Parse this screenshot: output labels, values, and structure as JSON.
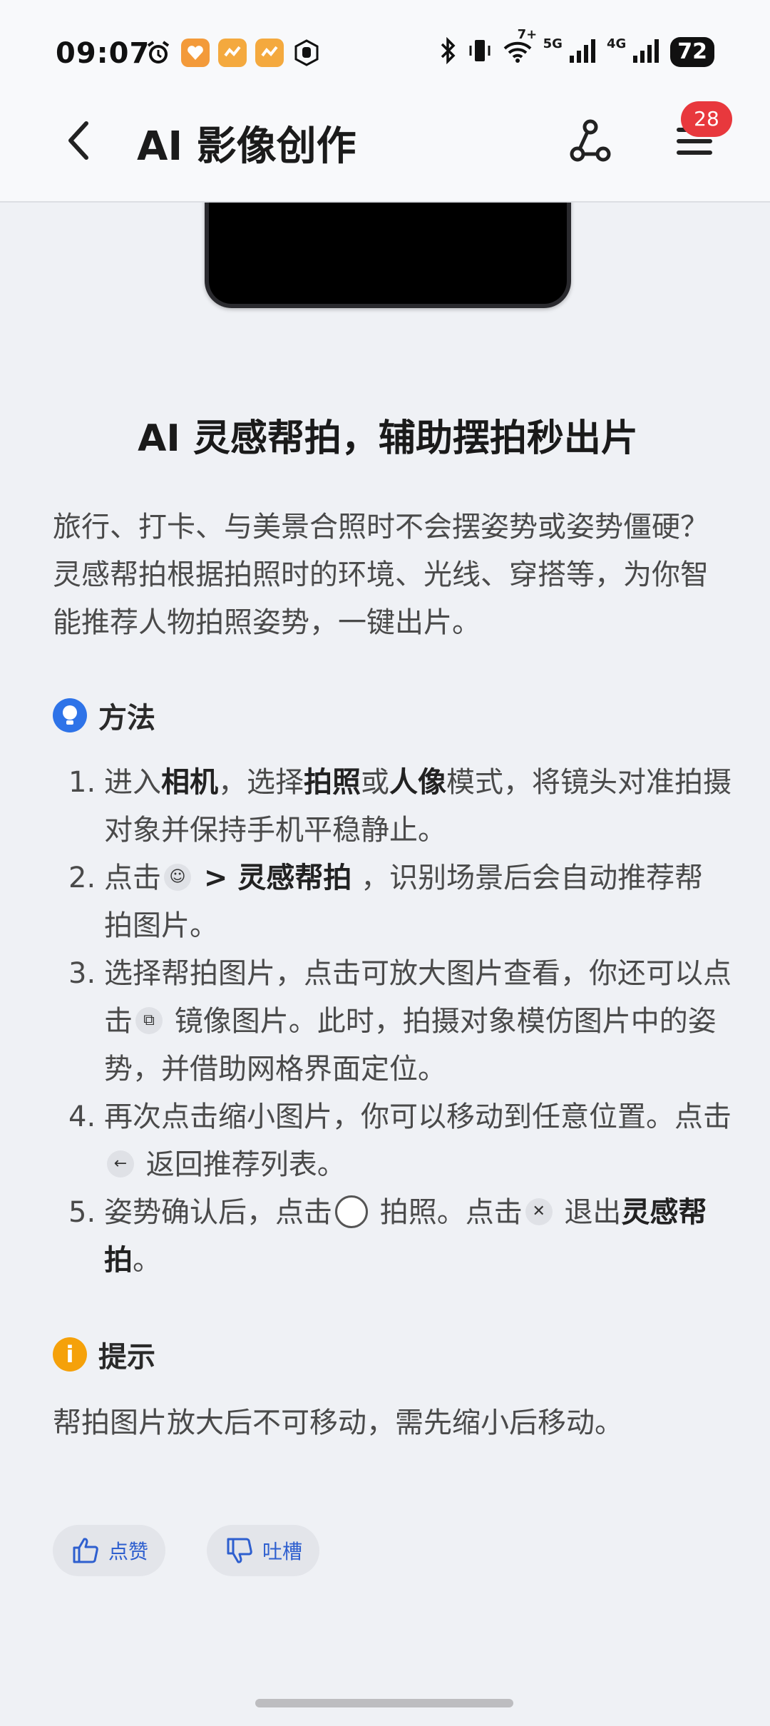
{
  "status_bar": {
    "time": "09:07",
    "battery": "72",
    "net1": "5G",
    "net2": "4G",
    "wifi_label": "7+"
  },
  "header": {
    "title": "AI 影像创作",
    "badge": "28"
  },
  "article": {
    "title": "AI 灵感帮拍，辅助摆拍秒出片",
    "intro": "旅行、打卡、与美景合照时不会摆姿势或姿势僵硬？灵感帮拍根据拍照时的环境、光线、穿搭等，为你智能推荐人物拍照姿势，一键出片。",
    "method_heading": "方法",
    "steps": {
      "s1": {
        "num": "1.",
        "a": "进入",
        "b": "相机",
        "c": "，选择",
        "d": "拍照",
        "e": "或",
        "f": "人像",
        "g": "模式，将镜头对准拍摄对象并保持手机平稳静止。"
      },
      "s2": {
        "num": "2.",
        "a": "点击",
        "b": " > 灵感帮拍",
        "c": " ，识别场景后会自动推荐帮拍图片。"
      },
      "s3": {
        "num": "3.",
        "a": "选择帮拍图片，点击可放大图片查看，你还可以点击",
        "b": " 镜像图片。此时，拍摄对象模仿图片中的姿势，并借助网格界面定位。"
      },
      "s4": {
        "num": "4.",
        "a": "再次点击缩小图片，你可以移动到任意位置。点击",
        "b": " 返回推荐列表。"
      },
      "s5": {
        "num": "5.",
        "a": "姿势确认后，点击",
        "b": " 拍照。点击",
        "c": " 退出",
        "d": "灵感帮拍",
        "e": "。"
      }
    },
    "tip_heading": "提示",
    "tip_text": "帮拍图片放大后不可移动，需先缩小后移动。"
  },
  "feedback": {
    "like_label": "点赞",
    "dislike_label": "吐槽"
  },
  "colors": {
    "background": "#eff1f5",
    "accent_blue": "#2e73e8",
    "tip_orange": "#f5a10a",
    "badge_red": "#e8383d",
    "feedback_text": "#2e5fcf"
  },
  "icons": [
    "alarm-icon",
    "health-app-icon",
    "hand-icon",
    "bluetooth-icon",
    "vibrate-icon",
    "wifi-icon",
    "signal-icon",
    "back-icon",
    "share-icon",
    "menu-icon",
    "lightbulb-icon",
    "info-icon",
    "thumbs-up-icon",
    "thumbs-down-icon"
  ]
}
